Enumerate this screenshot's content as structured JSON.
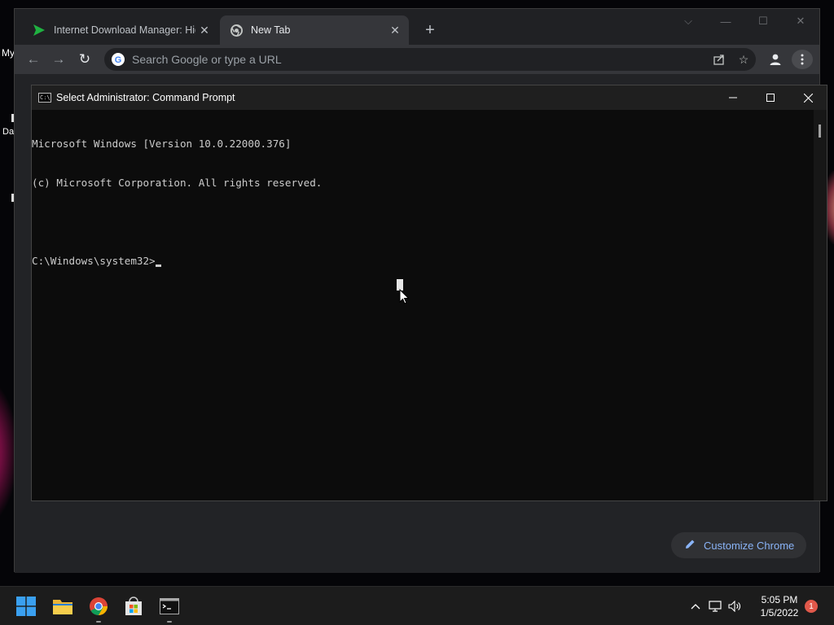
{
  "desktop": {
    "labels": [
      "My",
      "Da"
    ]
  },
  "browser": {
    "tabs": [
      {
        "title": "Internet Download Manager: Hig",
        "icon": "idm-arrow-icon",
        "active": false
      },
      {
        "title": "New Tab",
        "icon": "chrome-icon",
        "active": true
      }
    ],
    "new_tab_label": "+",
    "omnibox_placeholder": "Search Google or type a URL",
    "customize_label": "Customize Chrome",
    "colors": {
      "accent": "#8ab4f8",
      "frame": "#202124",
      "toolbar": "#35363a"
    }
  },
  "cmd": {
    "title": "Select Administrator: Command Prompt",
    "lines": [
      "Microsoft Windows [Version 10.0.22000.376]",
      "(c) Microsoft Corporation. All rights reserved.",
      "",
      "C:\\Windows\\system32>"
    ]
  },
  "taskbar": {
    "apps": [
      "start-icon",
      "file-explorer-icon",
      "chrome-icon",
      "microsoft-store-icon",
      "terminal-icon"
    ],
    "time": "5:05 PM",
    "date": "1/5/2022",
    "notification_count": "1"
  }
}
